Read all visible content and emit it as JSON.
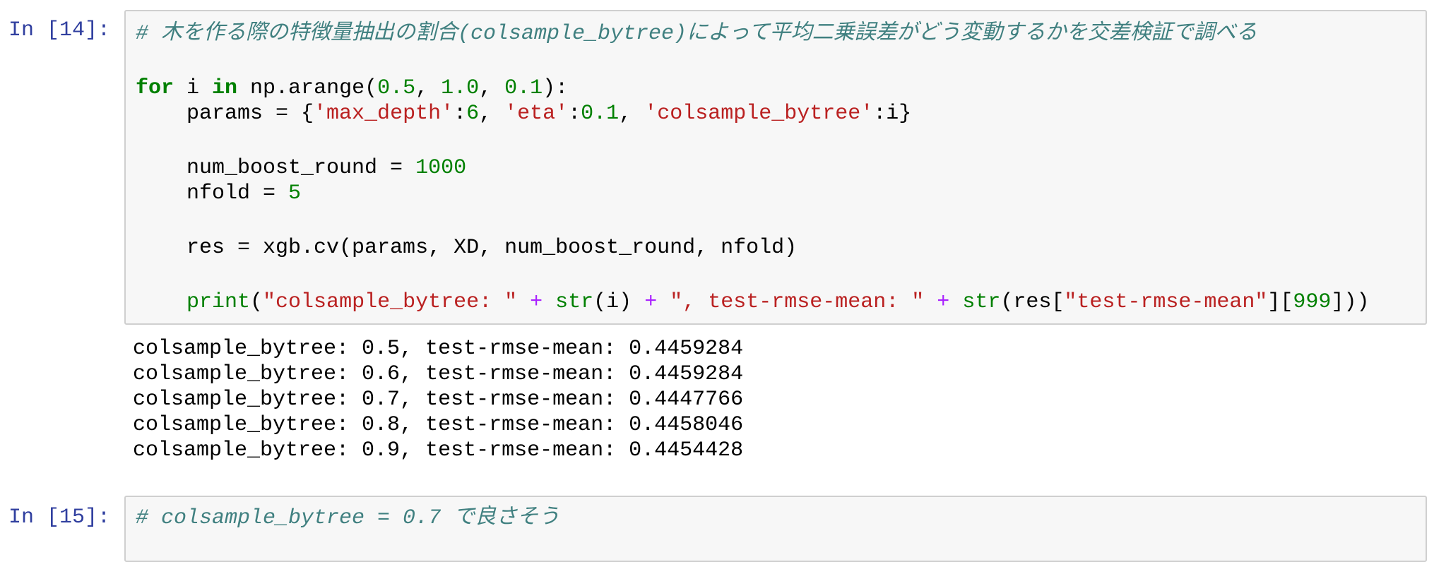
{
  "cells": [
    {
      "prompt": "In [14]:",
      "lines": [
        [
          {
            "t": "# 木を作る際の特徴量抽出の割合(colsample_bytree)によって平均二乗誤差がどう変動するかを交差検証で調べる",
            "k": "c"
          }
        ],
        [],
        [
          {
            "t": "for",
            "k": "k"
          },
          {
            "t": " i ",
            "k": "p"
          },
          {
            "t": "in",
            "k": "k"
          },
          {
            "t": " np.arange(",
            "k": "p"
          },
          {
            "t": "0.5",
            "k": "n"
          },
          {
            "t": ", ",
            "k": "p"
          },
          {
            "t": "1.0",
            "k": "n"
          },
          {
            "t": ", ",
            "k": "p"
          },
          {
            "t": "0.1",
            "k": "n"
          },
          {
            "t": "):",
            "k": "p"
          }
        ],
        [
          {
            "t": "    params = {",
            "k": "p"
          },
          {
            "t": "'max_depth'",
            "k": "s"
          },
          {
            "t": ":",
            "k": "p"
          },
          {
            "t": "6",
            "k": "n"
          },
          {
            "t": ", ",
            "k": "p"
          },
          {
            "t": "'eta'",
            "k": "s"
          },
          {
            "t": ":",
            "k": "p"
          },
          {
            "t": "0.1",
            "k": "n"
          },
          {
            "t": ", ",
            "k": "p"
          },
          {
            "t": "'colsample_bytree'",
            "k": "s"
          },
          {
            "t": ":i}",
            "k": "p"
          }
        ],
        [],
        [
          {
            "t": "    num_boost_round = ",
            "k": "p"
          },
          {
            "t": "1000",
            "k": "n"
          }
        ],
        [
          {
            "t": "    nfold = ",
            "k": "p"
          },
          {
            "t": "5",
            "k": "n"
          }
        ],
        [],
        [
          {
            "t": "    res = xgb.cv(params, XD, num_boost_round, nfold)",
            "k": "p"
          }
        ],
        [],
        [
          {
            "t": "    ",
            "k": "p"
          },
          {
            "t": "print",
            "k": "b"
          },
          {
            "t": "(",
            "k": "p"
          },
          {
            "t": "\"colsample_bytree: \"",
            "k": "s"
          },
          {
            "t": " ",
            "k": "p"
          },
          {
            "t": "+",
            "k": "o"
          },
          {
            "t": " ",
            "k": "p"
          },
          {
            "t": "str",
            "k": "b"
          },
          {
            "t": "(i) ",
            "k": "p"
          },
          {
            "t": "+",
            "k": "o"
          },
          {
            "t": " ",
            "k": "p"
          },
          {
            "t": "\", test-rmse-mean: \"",
            "k": "s"
          },
          {
            "t": " ",
            "k": "p"
          },
          {
            "t": "+",
            "k": "o"
          },
          {
            "t": " ",
            "k": "p"
          },
          {
            "t": "str",
            "k": "b"
          },
          {
            "t": "(res[",
            "k": "p"
          },
          {
            "t": "\"test-rmse-mean\"",
            "k": "s"
          },
          {
            "t": "][",
            "k": "p"
          },
          {
            "t": "999",
            "k": "n"
          },
          {
            "t": "]))",
            "k": "p"
          }
        ]
      ],
      "output": [
        "colsample_bytree: 0.5, test-rmse-mean: 0.4459284",
        "colsample_bytree: 0.6, test-rmse-mean: 0.4459284",
        "colsample_bytree: 0.7, test-rmse-mean: 0.4447766",
        "colsample_bytree: 0.8, test-rmse-mean: 0.4458046",
        "colsample_bytree: 0.9, test-rmse-mean: 0.4454428"
      ]
    },
    {
      "prompt": "In [15]:",
      "lines": [
        [
          {
            "t": "# colsample_bytree = 0.7 で良さそう",
            "k": "c"
          }
        ]
      ]
    }
  ]
}
